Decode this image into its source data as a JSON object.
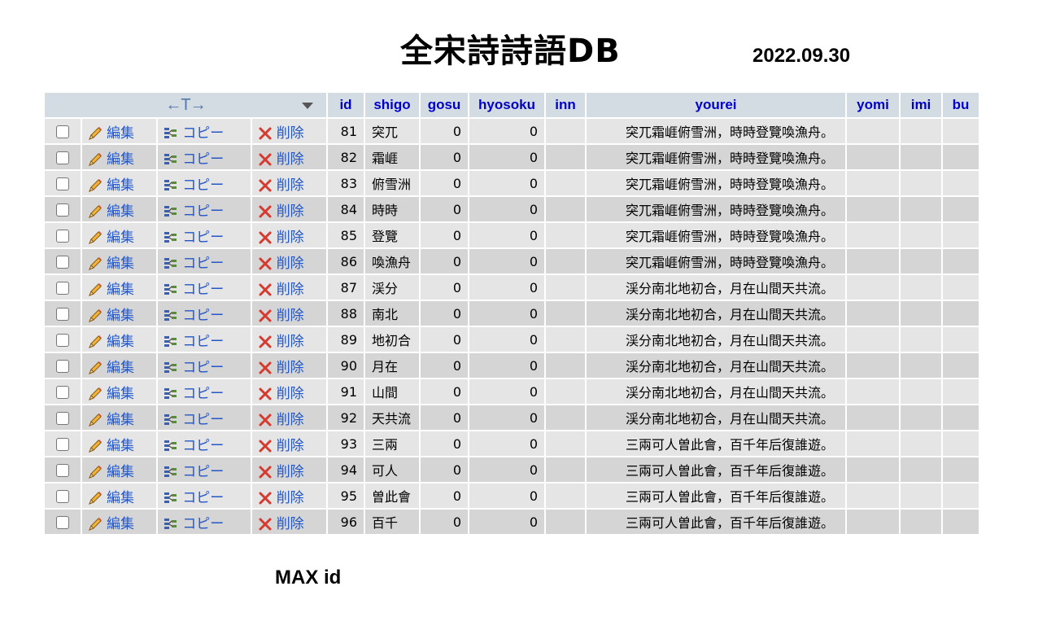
{
  "title": "全宋詩詩語DB",
  "date": "2022.09.30",
  "footer_label": "MAX id",
  "actions": {
    "edit": "編集",
    "copy": "コピー",
    "delete": "削除"
  },
  "header": {
    "nav_arrows": "←T→",
    "columns": [
      "id",
      "shigo",
      "gosu",
      "hyosoku",
      "inn",
      "yourei",
      "yomi",
      "imi",
      "bu"
    ]
  },
  "rows": [
    {
      "id": "81",
      "shigo": "突兀",
      "gosu": "0",
      "hyosoku": "0",
      "inn": "",
      "yourei": "突兀霜崕俯雪洲，時時登覽喚漁舟。",
      "yomi": "",
      "imi": "",
      "bu": ""
    },
    {
      "id": "82",
      "shigo": "霜崕",
      "gosu": "0",
      "hyosoku": "0",
      "inn": "",
      "yourei": "突兀霜崕俯雪洲，時時登覽喚漁舟。",
      "yomi": "",
      "imi": "",
      "bu": ""
    },
    {
      "id": "83",
      "shigo": "俯雪洲",
      "gosu": "0",
      "hyosoku": "0",
      "inn": "",
      "yourei": "突兀霜崕俯雪洲，時時登覽喚漁舟。",
      "yomi": "",
      "imi": "",
      "bu": ""
    },
    {
      "id": "84",
      "shigo": "時時",
      "gosu": "0",
      "hyosoku": "0",
      "inn": "",
      "yourei": "突兀霜崕俯雪洲，時時登覽喚漁舟。",
      "yomi": "",
      "imi": "",
      "bu": ""
    },
    {
      "id": "85",
      "shigo": "登覽",
      "gosu": "0",
      "hyosoku": "0",
      "inn": "",
      "yourei": "突兀霜崕俯雪洲，時時登覽喚漁舟。",
      "yomi": "",
      "imi": "",
      "bu": ""
    },
    {
      "id": "86",
      "shigo": "喚漁舟",
      "gosu": "0",
      "hyosoku": "0",
      "inn": "",
      "yourei": "突兀霜崕俯雪洲，時時登覽喚漁舟。",
      "yomi": "",
      "imi": "",
      "bu": ""
    },
    {
      "id": "87",
      "shigo": "渓分",
      "gosu": "0",
      "hyosoku": "0",
      "inn": "",
      "yourei": "渓分南北地初合，月在山間天共流。",
      "yomi": "",
      "imi": "",
      "bu": ""
    },
    {
      "id": "88",
      "shigo": "南北",
      "gosu": "0",
      "hyosoku": "0",
      "inn": "",
      "yourei": "渓分南北地初合，月在山間天共流。",
      "yomi": "",
      "imi": "",
      "bu": ""
    },
    {
      "id": "89",
      "shigo": "地初合",
      "gosu": "0",
      "hyosoku": "0",
      "inn": "",
      "yourei": "渓分南北地初合，月在山間天共流。",
      "yomi": "",
      "imi": "",
      "bu": ""
    },
    {
      "id": "90",
      "shigo": "月在",
      "gosu": "0",
      "hyosoku": "0",
      "inn": "",
      "yourei": "渓分南北地初合，月在山間天共流。",
      "yomi": "",
      "imi": "",
      "bu": ""
    },
    {
      "id": "91",
      "shigo": "山間",
      "gosu": "0",
      "hyosoku": "0",
      "inn": "",
      "yourei": "渓分南北地初合，月在山間天共流。",
      "yomi": "",
      "imi": "",
      "bu": ""
    },
    {
      "id": "92",
      "shigo": "天共流",
      "gosu": "0",
      "hyosoku": "0",
      "inn": "",
      "yourei": "渓分南北地初合，月在山間天共流。",
      "yomi": "",
      "imi": "",
      "bu": ""
    },
    {
      "id": "93",
      "shigo": "三兩",
      "gosu": "0",
      "hyosoku": "0",
      "inn": "",
      "yourei": "三兩可人曽此會，百千年后復誰遊。",
      "yomi": "",
      "imi": "",
      "bu": ""
    },
    {
      "id": "94",
      "shigo": "可人",
      "gosu": "0",
      "hyosoku": "0",
      "inn": "",
      "yourei": "三兩可人曽此會，百千年后復誰遊。",
      "yomi": "",
      "imi": "",
      "bu": ""
    },
    {
      "id": "95",
      "shigo": "曽此會",
      "gosu": "0",
      "hyosoku": "0",
      "inn": "",
      "yourei": "三兩可人曽此會，百千年后復誰遊。",
      "yomi": "",
      "imi": "",
      "bu": ""
    },
    {
      "id": "96",
      "shigo": "百千",
      "gosu": "0",
      "hyosoku": "0",
      "inn": "",
      "yourei": "三兩可人曽此會，百千年后復誰遊。",
      "yomi": "",
      "imi": "",
      "bu": ""
    }
  ]
}
